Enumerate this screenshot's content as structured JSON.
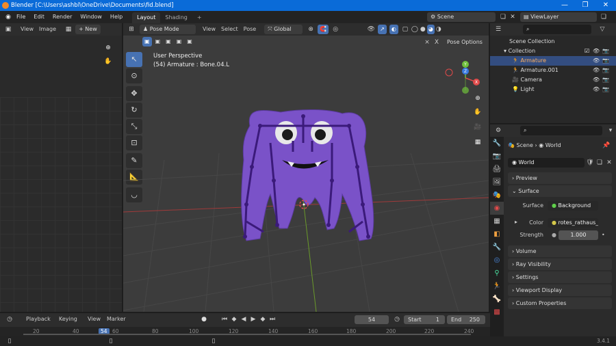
{
  "window": {
    "title": "Blender [C:\\Users\\ashbl\\OneDrive\\Documents\\fid.blend]",
    "minimize": "—",
    "maximize": "❐",
    "close": "✕"
  },
  "menu": {
    "items": [
      "File",
      "Edit",
      "Render",
      "Window",
      "Help"
    ],
    "workspace_tabs": [
      "Layout",
      "Shading"
    ],
    "add_tab": "+",
    "scene": "Scene",
    "view_layer": "ViewLayer"
  },
  "image_editor": {
    "view": "View",
    "image": "Image",
    "new_button": "+ New"
  },
  "viewport": {
    "mode": "Pose Mode",
    "view": "View",
    "select": "Select",
    "pose": "Pose",
    "transform_orientation": "Global",
    "perspective_label": "User Perspective",
    "active_object": "(54) Armature : Bone.04.L",
    "pose_options": "Pose Options",
    "gizmo_axes": [
      "X",
      "Y",
      "Z"
    ]
  },
  "outliner": {
    "scene_collection": "Scene Collection",
    "collection": "Collection",
    "items": [
      "Armature",
      "Armature.001",
      "Camera",
      "Light"
    ]
  },
  "properties": {
    "breadcrumb_scene": "Scene",
    "breadcrumb_world": "World",
    "world_name": "World",
    "panels": {
      "preview": "Preview",
      "surface": "Surface",
      "volume": "Volume",
      "ray_visibility": "Ray Visibility",
      "settings": "Settings",
      "viewport_display": "Viewport Display",
      "custom_properties": "Custom Properties"
    },
    "surface_label": "Surface",
    "surface_value": "Background",
    "color_label": "Color",
    "color_value": "rotes_rathaus_...",
    "strength_label": "Strength",
    "strength_value": "1.000"
  },
  "timeline": {
    "playback": "Playback",
    "keying": "Keying",
    "view": "View",
    "marker": "Marker",
    "current_frame": "54",
    "start_label": "Start",
    "start_value": "1",
    "end_label": "End",
    "end_value": "250",
    "ticks": [
      "20",
      "40",
      "54",
      "60",
      "80",
      "100",
      "120",
      "140",
      "160",
      "180",
      "200",
      "220",
      "240"
    ]
  },
  "status": {
    "version": "3.4.1"
  },
  "colors": {
    "accent": "#4772b3",
    "title_bar": "#0a6bd8",
    "character": "#7a52c8",
    "armature": "#3b1a7a"
  }
}
